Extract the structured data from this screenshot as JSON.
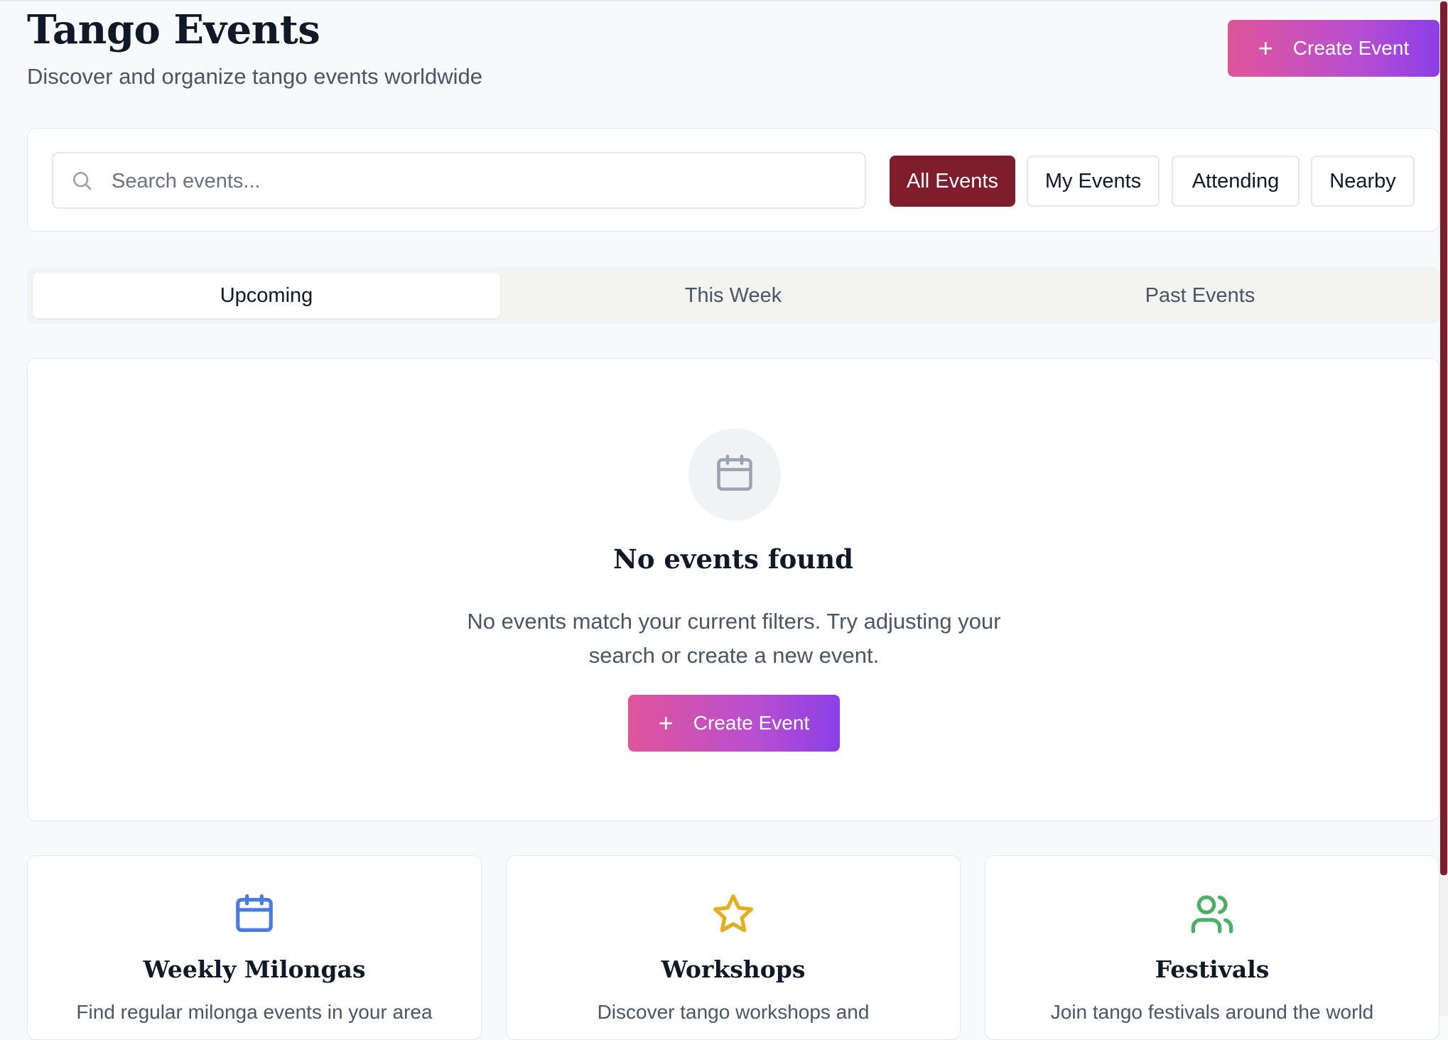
{
  "header": {
    "title": "Tango Events",
    "subtitle": "Discover and organize tango events worldwide",
    "create_label": "Create Event"
  },
  "search": {
    "placeholder": "Search events...",
    "value": ""
  },
  "filters": [
    {
      "label": "All Events",
      "active": true
    },
    {
      "label": "My Events",
      "active": false
    },
    {
      "label": "Attending",
      "active": false
    },
    {
      "label": "Nearby",
      "active": false
    }
  ],
  "tabs": [
    {
      "label": "Upcoming",
      "active": true
    },
    {
      "label": "This Week",
      "active": false
    },
    {
      "label": "Past Events",
      "active": false
    }
  ],
  "empty_state": {
    "icon": "calendar-icon",
    "title": "No events found",
    "text": "No events match your current filters. Try adjusting your search or create a new event.",
    "button_label": "Create Event"
  },
  "features": [
    {
      "icon": "calendar-icon",
      "title": "Weekly Milongas",
      "description": "Find regular milonga events in your area",
      "color": "#4a7ce0"
    },
    {
      "icon": "star-icon",
      "title": "Workshops",
      "description": "Discover tango workshops and",
      "color": "#e0b020"
    },
    {
      "icon": "users-icon",
      "title": "Festivals",
      "description": "Join tango festivals around the world",
      "color": "#4caf66"
    }
  ],
  "colors": {
    "accent": "#7f1d2d",
    "gradient_start": "#e0559a",
    "gradient_end": "#8b3fe6"
  }
}
